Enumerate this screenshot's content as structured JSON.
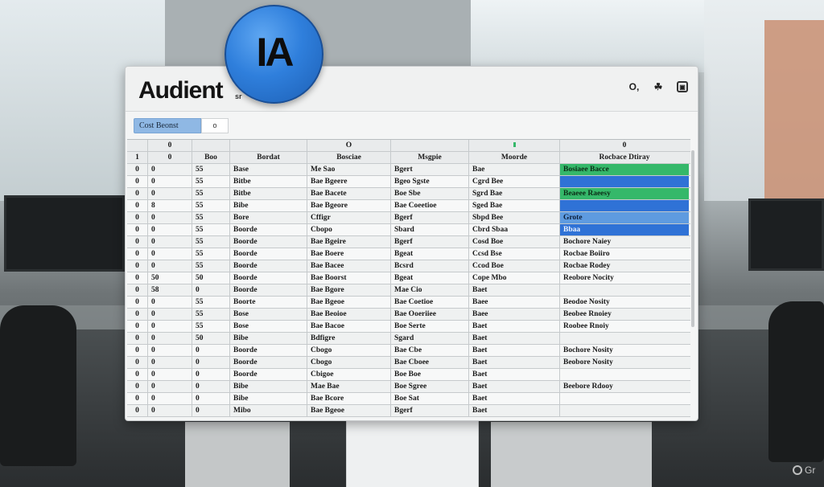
{
  "app": {
    "title": "Audient",
    "title_sub": "sr",
    "logo_text": "IA"
  },
  "header_icons": [
    "search-icon",
    "cloud-icon",
    "window-icon"
  ],
  "header_icon_glyphs": [
    "O,",
    "☘",
    "▣"
  ],
  "toolbar": {
    "button_label": "Cost Beonst",
    "small_label": "o"
  },
  "columns": [
    "",
    "0",
    "",
    "",
    "O",
    "",
    "",
    "0"
  ],
  "header_row": [
    "1",
    "0",
    "Boo",
    "Bordat",
    "Bosciae",
    "Msgpie",
    "Moorde",
    "Rocbace Dtiray"
  ],
  "rows": [
    {
      "cells": [
        "0",
        "0",
        "55",
        "Base",
        "Me Sao",
        "Bgert",
        "Bae",
        "Bosiaee Bacce"
      ],
      "status": "green"
    },
    {
      "cells": [
        "0",
        "0",
        "55",
        "Bitbe",
        "Bae Bgeere",
        "Bgeo Sgste",
        "Cgrd Bee",
        ""
      ],
      "status": "blue"
    },
    {
      "cells": [
        "0",
        "0",
        "55",
        "Bitbe",
        "Bae Bacete",
        "Boe Sbe",
        "Sgrd Bae",
        "Beaeee Raeesy"
      ],
      "status": "green"
    },
    {
      "cells": [
        "0",
        "8",
        "55",
        "Bibe",
        "Bae Bgeore",
        "Bae Coeetioe",
        "Sged Bae",
        ""
      ],
      "status": "blue"
    },
    {
      "cells": [
        "0",
        "0",
        "55",
        "Bore",
        "Cffigr",
        "Bgerf",
        "Sbpd Bee",
        "Grote"
      ],
      "status": "lblue"
    },
    {
      "cells": [
        "0",
        "0",
        "55",
        "Boorde",
        "Cbopo",
        "Sbard",
        "Cbrd Sbaa",
        "Bbaa"
      ],
      "status": "blue"
    },
    {
      "cells": [
        "0",
        "0",
        "55",
        "Boorde",
        "Bae Bgeire",
        "Bgerf",
        "Cosd Boe",
        "Bochore Naiey"
      ],
      "status": ""
    },
    {
      "cells": [
        "0",
        "0",
        "55",
        "Boorde",
        "Bae Boere",
        "Bgeat",
        "Ccsd Bse",
        "Rocbae Boiiro"
      ],
      "status": ""
    },
    {
      "cells": [
        "0",
        "0",
        "55",
        "Boorde",
        "Bae Bacee",
        "Bcsrd",
        "Ccod Boe",
        "Rocbae Rodey"
      ],
      "status": ""
    },
    {
      "cells": [
        "0",
        "50",
        "50",
        "Boorde",
        "Bae Boorst",
        "Bgeat",
        "Cope Mbo",
        "Reobore Nocity"
      ],
      "status": ""
    },
    {
      "cells": [
        "0",
        "58",
        "0",
        "Boorde",
        "Bae Bgore",
        "Mae Cio",
        "Baet",
        ""
      ],
      "status": ""
    },
    {
      "cells": [
        "0",
        "0",
        "55",
        "Boorte",
        "Bae Bgeoe",
        "Bae Coetioe",
        "Baee",
        "Beodoe Nosity"
      ],
      "status": ""
    },
    {
      "cells": [
        "0",
        "0",
        "55",
        "Bose",
        "Bae Beoioe",
        "Bae Ooeriiee",
        "Baee",
        "Beobee Rnoiey"
      ],
      "status": ""
    },
    {
      "cells": [
        "0",
        "0",
        "55",
        "Bose",
        "Bae Bacoe",
        "Boe Serte",
        "Baet",
        "Roobee Rnoiy"
      ],
      "status": ""
    },
    {
      "cells": [
        "0",
        "0",
        "50",
        "Bibe",
        "Bdfigre",
        "Sgard",
        "Baet",
        ""
      ],
      "status": ""
    },
    {
      "cells": [
        "0",
        "0",
        "0",
        "Boorde",
        "Cbogo",
        "Bae Cbe",
        "Baet",
        "Bochore Nosity"
      ],
      "status": ""
    },
    {
      "cells": [
        "0",
        "0",
        "0",
        "Boorde",
        "Cbogo",
        "Bae Cboee",
        "Baet",
        "Beobore Nosity"
      ],
      "status": ""
    },
    {
      "cells": [
        "0",
        "0",
        "0",
        "Boorde",
        "Cbigoe",
        "Boe Boe",
        "Baet",
        ""
      ],
      "status": ""
    },
    {
      "cells": [
        "0",
        "0",
        "0",
        "Bibe",
        "Mae Bae",
        "Boe Sgree",
        "Baet",
        "Beebore Rdooy"
      ],
      "status": ""
    },
    {
      "cells": [
        "0",
        "0",
        "0",
        "Bibe",
        "Bae Bcore",
        "Boe Sat",
        "Baet",
        ""
      ],
      "status": ""
    },
    {
      "cells": [
        "0",
        "0",
        "0",
        "Mibo",
        "Bae Bgeoe",
        "Bgerf",
        "Baet",
        ""
      ],
      "status": ""
    }
  ],
  "watermark": "Gr",
  "colors": {
    "status_green": "#35b86a",
    "status_blue": "#2f72d6",
    "status_light_blue": "#5e9be0",
    "logo_blue": "#2f7fdc"
  }
}
